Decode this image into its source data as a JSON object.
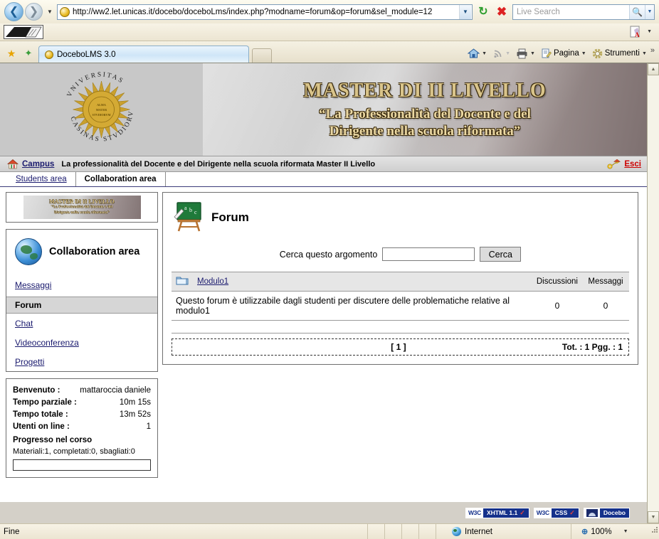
{
  "browser": {
    "url": "http://ww2.let.unicas.it/docebo/doceboLms/index.php?modname=forum&op=forum&sel_module=12",
    "search_placeholder": "Live Search",
    "tab_title": "DoceboLMS 3.0",
    "commands": [
      {
        "label": "Pagina",
        "icon": "page-icon"
      },
      {
        "label": "Strumenti",
        "icon": "gear-icon"
      }
    ],
    "overflow_label": "»"
  },
  "statusbar": {
    "status_text": "Fine",
    "zone": "Internet",
    "zoom": "100%"
  },
  "banner": {
    "seal_text": "VNIVERSITAS CASINAS STVDIORVM",
    "line1": "MASTER  DI II LIVELLO",
    "line2": "“La Professionalità del Docente e del",
    "line3": "Dirigente nella scuola riformata”"
  },
  "campus_bar": {
    "home_label": "Campus",
    "course_title": "La professionalità del Docente e del Dirigente nella scuola riformata Master II Livello",
    "logout_label": "Esci"
  },
  "page_tabs": [
    {
      "label": "Students area",
      "active": false
    },
    {
      "label": "Collaboration area",
      "active": true
    }
  ],
  "sidebar": {
    "mini_banner": {
      "line1": "MASTER  DI II LIVELLO",
      "line2": "“La Professionalità del Docente e del",
      "line3": "Dirigente nella scuola riformata”"
    },
    "title": "Collaboration area",
    "items": [
      {
        "label": "Messaggi",
        "type": "link"
      },
      {
        "label": "Forum",
        "type": "section"
      },
      {
        "label": "Chat",
        "type": "link"
      },
      {
        "label": "Videoconferenza",
        "type": "link"
      },
      {
        "label": "Progetti",
        "type": "link"
      }
    ],
    "info": {
      "rows": [
        {
          "label": "Benvenuto :",
          "value": "mattaroccia daniele"
        },
        {
          "label": "Tempo parziale :",
          "value": "10m 15s"
        },
        {
          "label": "Tempo totale :",
          "value": "13m 52s"
        },
        {
          "label": "Utenti on line :",
          "value": "1"
        }
      ],
      "progress_heading": "Progresso nel corso",
      "progress_text": "Materiali:1, completati:0, sbagliati:0",
      "progress_percent": 0
    }
  },
  "main": {
    "heading": "Forum",
    "search_label": "Cerca questo argomento",
    "search_value": "",
    "search_button": "Cerca",
    "table": {
      "name_header": "Modulo1",
      "col_discussions": "Discussioni",
      "col_messages": "Messaggi",
      "rows": [
        {
          "description": "Questo forum è utilizzabile dagli studenti per discutere delle problematiche relative al modulo1",
          "discussions": "0",
          "messages": "0"
        }
      ]
    },
    "pager": {
      "pages": "[ 1 ]",
      "totals": "Tot. : 1 Pgg. : 1"
    }
  },
  "footer": {
    "badges": [
      {
        "left": "W3C",
        "right": "XHTML 1.1"
      },
      {
        "left": "W3C",
        "right": "CSS"
      },
      {
        "left": "",
        "right": "Docebo"
      }
    ]
  }
}
